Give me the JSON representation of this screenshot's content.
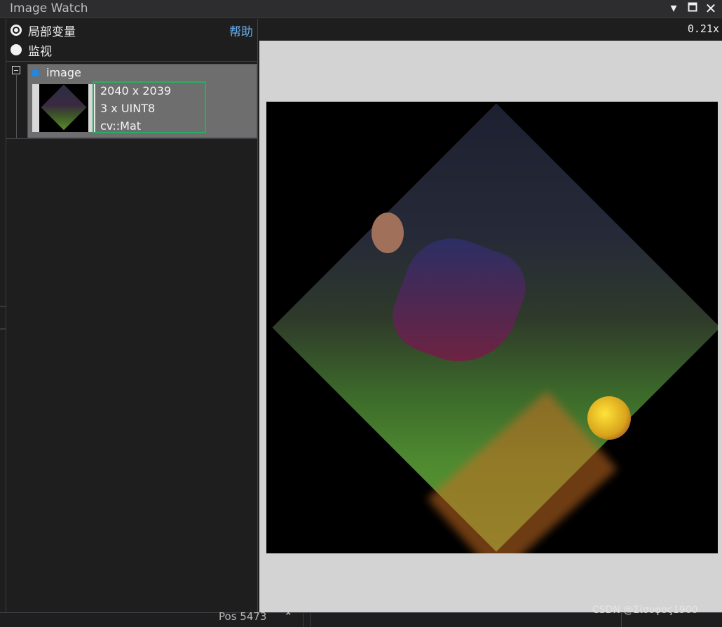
{
  "window": {
    "title": "Image Watch"
  },
  "left_panel": {
    "radio_options": [
      {
        "label": "局部变量",
        "checked": true
      },
      {
        "label": "监视",
        "checked": false
      }
    ],
    "help_link": "帮助",
    "items": [
      {
        "name": "image",
        "dimensions": "2040 x 2039",
        "channels": "3 x UINT8",
        "type": "cv::Mat"
      }
    ]
  },
  "viewer": {
    "zoom": "0.21x"
  },
  "statusbar": {
    "pos_text": "Pos  5473",
    "caret": "⌃"
  },
  "watermark": "CSDN @Σίσυφος1900",
  "colors": {
    "accent_blue": "#1e88e5",
    "selection_green": "#27ae60",
    "help_link": "#6ab0f3"
  }
}
